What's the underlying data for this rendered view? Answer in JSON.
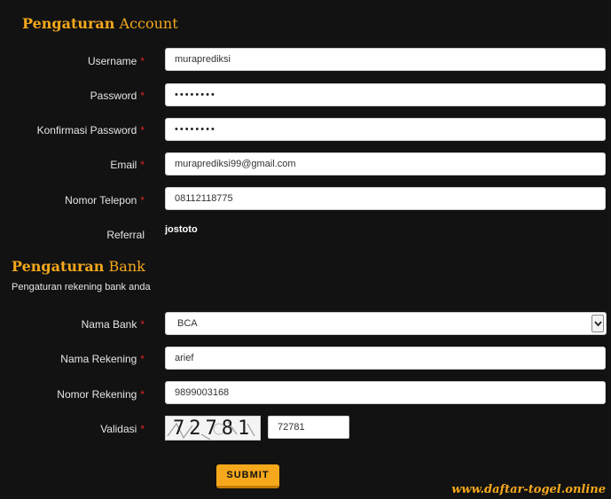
{
  "account_section": {
    "title_bold": "Pengaturan",
    "title_light": "Account"
  },
  "fields": {
    "username": {
      "label": "Username",
      "required": "*",
      "value": "muraprediksi"
    },
    "password": {
      "label": "Password",
      "required": "*",
      "value": "••••••••"
    },
    "confirm_password": {
      "label": "Konfirmasi Password",
      "required": "*",
      "value": "••••••••"
    },
    "email": {
      "label": "Email",
      "required": "*",
      "value": "muraprediksi99@gmail.com"
    },
    "phone": {
      "label": "Nomor Telepon",
      "required": "*",
      "value": "08112118775"
    },
    "referral": {
      "label": "Referral",
      "value": "jostoto"
    }
  },
  "bank_section": {
    "title_bold": "Pengaturan",
    "title_light": "Bank",
    "description": "Pengaturan rekening bank anda"
  },
  "bank_fields": {
    "bank_name": {
      "label": "Nama Bank",
      "required": "*",
      "value": "BCA"
    },
    "account_name": {
      "label": "Nama Rekening",
      "required": "*",
      "value": "arief"
    },
    "account_number": {
      "label": "Nomor Rekening",
      "required": "*",
      "value": "9899003168"
    },
    "validation": {
      "label": "Validasi",
      "required": "*",
      "captcha_text": "72781",
      "value": "72781"
    }
  },
  "submit_label": "SUBMIT",
  "watermark": "www.daftar-togel.online",
  "colors": {
    "accent": "#f5a81c",
    "required": "#e02424",
    "background": "#121212"
  },
  "icons": {
    "select_arrow": "chevron-down-icon"
  }
}
